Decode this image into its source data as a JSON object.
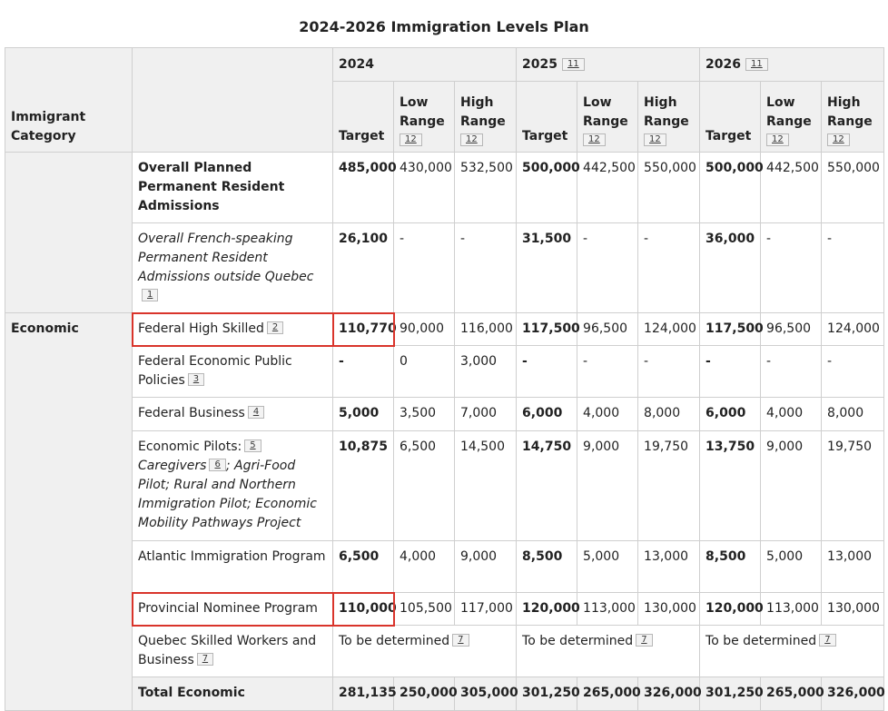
{
  "title": "2024-2026 Immigration Levels Plan",
  "header": {
    "category": "Immigrant Category",
    "years": [
      {
        "label": "2024",
        "footnote": ""
      },
      {
        "label": "2025",
        "footnote": "11"
      },
      {
        "label": "2026",
        "footnote": "11"
      }
    ],
    "target": "Target",
    "low_range": "Low Range",
    "high_range": "High Range",
    "range_footnote": "12"
  },
  "rows": {
    "overall": {
      "label": "Overall Planned Permanent Resident Admissions",
      "v": [
        "485,000",
        "430,000",
        "532,500",
        "500,000",
        "442,500",
        "550,000",
        "500,000",
        "442,500",
        "550,000"
      ]
    },
    "french": {
      "label": "Overall French-speaking Permanent Resident Admissions outside Quebec",
      "footnote": "1",
      "v": [
        "26,100",
        "-",
        "-",
        "31,500",
        "-",
        "-",
        "36,000",
        "-",
        "-"
      ]
    },
    "economic_category": "Economic",
    "fhs": {
      "label": "Federal High Skilled",
      "footnote": "2",
      "v": [
        "110,770",
        "90,000",
        "116,000",
        "117,500",
        "96,500",
        "124,000",
        "117,500",
        "96,500",
        "124,000"
      ]
    },
    "fepp": {
      "label": "Federal Economic Public Policies",
      "footnote": "3",
      "v": [
        "-",
        "0",
        "3,000",
        "-",
        "-",
        "-",
        "-",
        "-",
        "-"
      ]
    },
    "fb": {
      "label": "Federal Business",
      "footnote": "4",
      "v": [
        "5,000",
        "3,500",
        "7,000",
        "6,000",
        "4,000",
        "8,000",
        "6,000",
        "4,000",
        "8,000"
      ]
    },
    "pilots": {
      "label": "Economic Pilots:",
      "footnote": "5",
      "caregivers": "Caregivers",
      "caregivers_footnote": "6",
      "rest": "; Agri-Food Pilot; Rural and Northern Immigration Pilot; Economic Mobility Pathways Project",
      "v": [
        "10,875",
        "6,500",
        "14,500",
        "14,750",
        "9,000",
        "19,750",
        "13,750",
        "9,000",
        "19,750"
      ]
    },
    "aip": {
      "label": "Atlantic Immigration Program",
      "v": [
        "6,500",
        "4,000",
        "9,000",
        "8,500",
        "5,000",
        "13,000",
        "8,500",
        "5,000",
        "13,000"
      ]
    },
    "pnp": {
      "label": "Provincial Nominee Program",
      "v": [
        "110,000",
        "105,500",
        "117,000",
        "120,000",
        "113,000",
        "130,000",
        "120,000",
        "113,000",
        "130,000"
      ]
    },
    "quebec": {
      "label": "Quebec Skilled Workers and Business",
      "footnote": "7",
      "tbd": "To be determined",
      "tbd_footnote": "7"
    },
    "total": {
      "label": "Total Economic",
      "v": [
        "281,135",
        "250,000",
        "305,000",
        "301,250",
        "265,000",
        "326,000",
        "301,250",
        "265,000",
        "326,000"
      ]
    }
  }
}
